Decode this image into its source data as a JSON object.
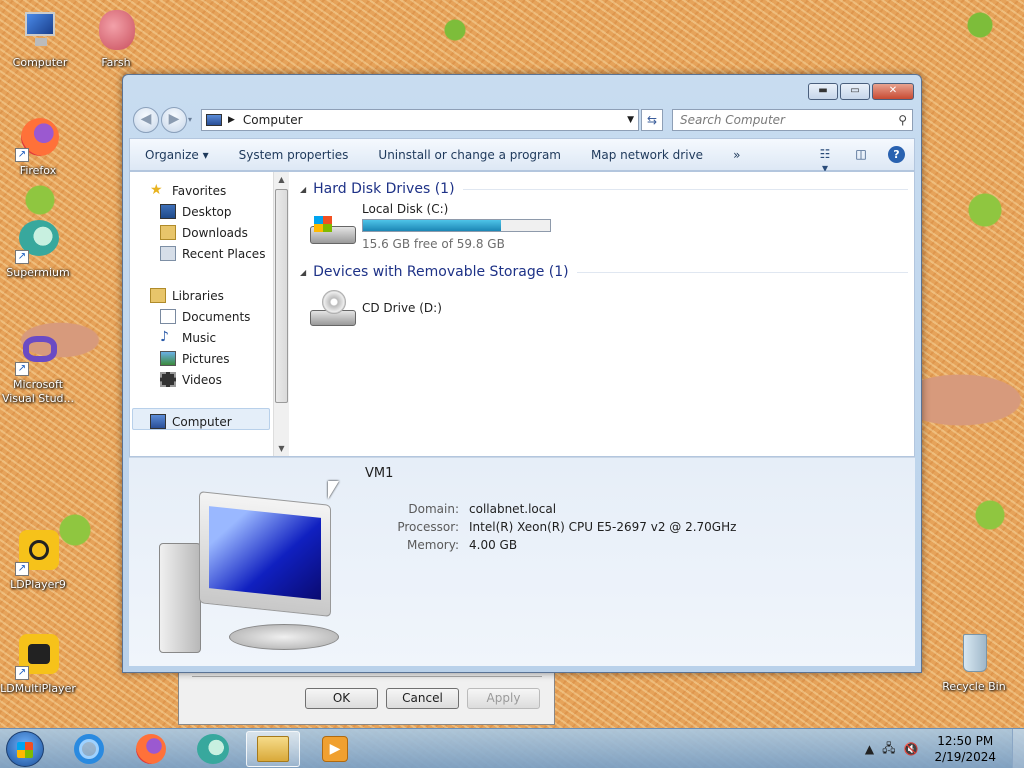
{
  "desktop": {
    "icons": [
      {
        "label": "Computer",
        "icon": "computer-icon"
      },
      {
        "label": "Farsh",
        "icon": "brain-icon"
      },
      {
        "label": "Firefox",
        "icon": "firefox-icon"
      },
      {
        "label": "Supermium",
        "icon": "supermium-icon"
      },
      {
        "label": "Microsoft Visual Stud...",
        "icon": "visual-studio-icon"
      },
      {
        "label": "LDPlayer9",
        "icon": "ldplayer-icon"
      },
      {
        "label": "LDMultiPlayer",
        "icon": "ldmultiplayer-icon"
      },
      {
        "label": "Recycle Bin",
        "icon": "recycle-bin-icon"
      }
    ]
  },
  "bg_dialog": {
    "ok": "OK",
    "cancel": "Cancel",
    "apply": "Apply"
  },
  "explorer": {
    "address": {
      "location": "Computer"
    },
    "search": {
      "placeholder": "Search Computer"
    },
    "toolbar": {
      "organize": "Organize ▾",
      "system_properties": "System properties",
      "uninstall": "Uninstall or change a program",
      "map_drive": "Map network drive",
      "more": "»"
    },
    "nav": {
      "favorites": "Favorites",
      "desktop": "Desktop",
      "downloads": "Downloads",
      "recent_places": "Recent Places",
      "libraries": "Libraries",
      "documents": "Documents",
      "music": "Music",
      "pictures": "Pictures",
      "videos": "Videos",
      "computer": "Computer"
    },
    "groups": {
      "hdd": "Hard Disk Drives (1)",
      "removable": "Devices with Removable Storage (1)"
    },
    "drives": {
      "c_name": "Local Disk (C:)",
      "c_free": "15.6 GB free of 59.8 GB",
      "c_used_fraction": 0.74,
      "d_name": "CD Drive (D:)"
    },
    "details": {
      "name": "VM1",
      "domain_label": "Domain:",
      "domain": "collabnet.local",
      "processor_label": "Processor:",
      "processor": "Intel(R) Xeon(R) CPU E5-2697 v2 @ 2.70GHz",
      "memory_label": "Memory:",
      "memory": "4.00 GB"
    }
  },
  "taskbar": {
    "time": "12:50 PM",
    "date": "2/19/2024"
  }
}
